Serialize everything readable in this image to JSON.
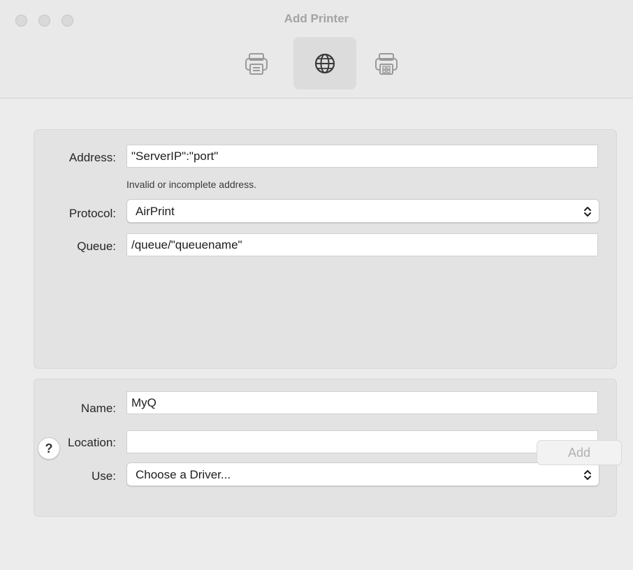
{
  "window": {
    "title": "Add Printer"
  },
  "toolbar": {
    "items": [
      {
        "icon": "printer-icon",
        "selected": false
      },
      {
        "icon": "globe-icon",
        "selected": true
      },
      {
        "icon": "windows-printer-icon",
        "selected": false
      }
    ]
  },
  "connection": {
    "address_label": "Address:",
    "address_value": "\"ServerIP\":\"port\"",
    "address_hint": "Invalid or incomplete address.",
    "protocol_label": "Protocol:",
    "protocol_value": "AirPrint",
    "queue_label": "Queue:",
    "queue_value": "/queue/\"queuename\""
  },
  "printer_info": {
    "name_label": "Name:",
    "name_value": "MyQ",
    "location_label": "Location:",
    "location_value": "",
    "use_label": "Use:",
    "use_value": "Choose a Driver..."
  },
  "footer": {
    "help_label": "?",
    "add_label": "Add",
    "add_enabled": false
  }
}
